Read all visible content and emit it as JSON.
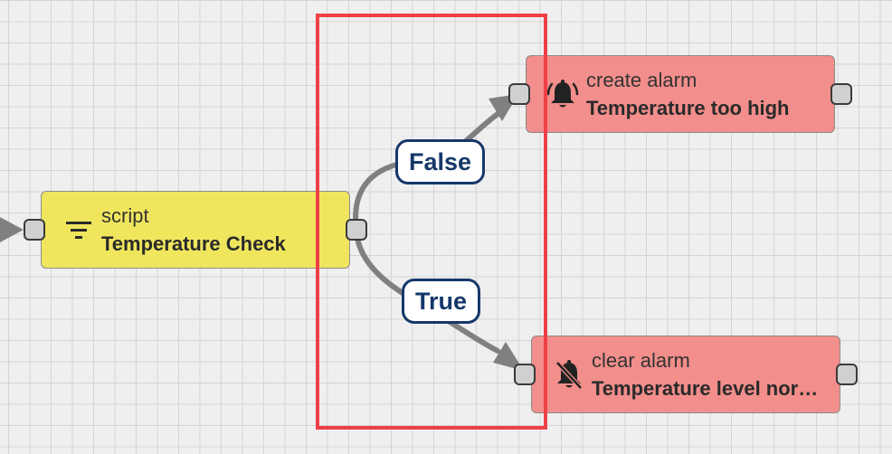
{
  "nodes": {
    "script": {
      "type": "script",
      "name": "Temperature Check",
      "icon": "filter-icon"
    },
    "create_alarm": {
      "type": "create alarm",
      "name": "Temperature too high",
      "icon": "alarm-bell-icon"
    },
    "clear_alarm": {
      "type": "clear alarm",
      "name": "Temperature level normal",
      "icon": "bell-off-icon"
    }
  },
  "edges": {
    "false_label": "False",
    "true_label": "True"
  },
  "colors": {
    "script_node": "#f0e65e",
    "alarm_node": "#f28e8b",
    "edge": "#808080",
    "label_border": "#15386a",
    "highlight": "#ef4046"
  }
}
